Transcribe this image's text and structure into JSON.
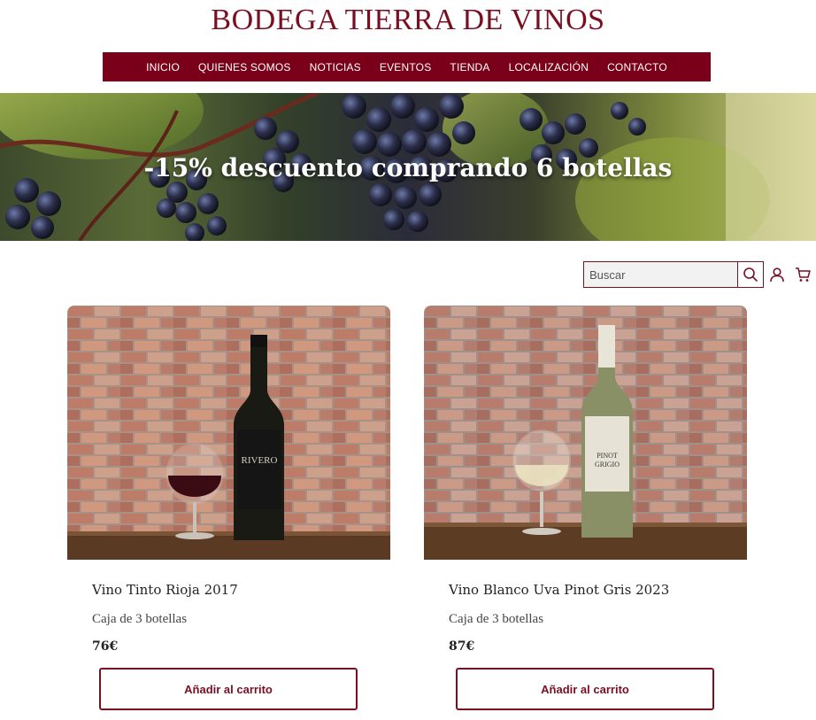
{
  "header": {
    "brand": "BODEGA TIERRA DE VINOS"
  },
  "nav": {
    "items": [
      "INICIO",
      "QUIENES SOMOS",
      "NOTICIAS",
      "EVENTOS",
      "TIENDA",
      "LOCALIZACIÓN",
      "CONTACTO"
    ]
  },
  "hero": {
    "text": "-15% descuento comprando 6 botellas"
  },
  "search": {
    "placeholder": "Buscar",
    "value": ""
  },
  "icons": {
    "search": "search-icon",
    "account": "user-icon",
    "cart": "cart-icon"
  },
  "products": [
    {
      "name": "Vino Tinto Rioja 2017",
      "subtitle": "Caja de 3 botellas",
      "price": "76€",
      "button": "Añadir al carrito",
      "label_top": "RIVERO",
      "wine": "red"
    },
    {
      "name": "Vino Blanco Uva Pinot Gris 2023",
      "subtitle": "Caja de 3 botellas",
      "price": "87€",
      "button": "Añadir al carrito",
      "label_top": "PINOT GRIGIO",
      "wine": "white"
    }
  ],
  "colors": {
    "brand": "#7a0f22",
    "nav_bg": "#7a0019"
  }
}
